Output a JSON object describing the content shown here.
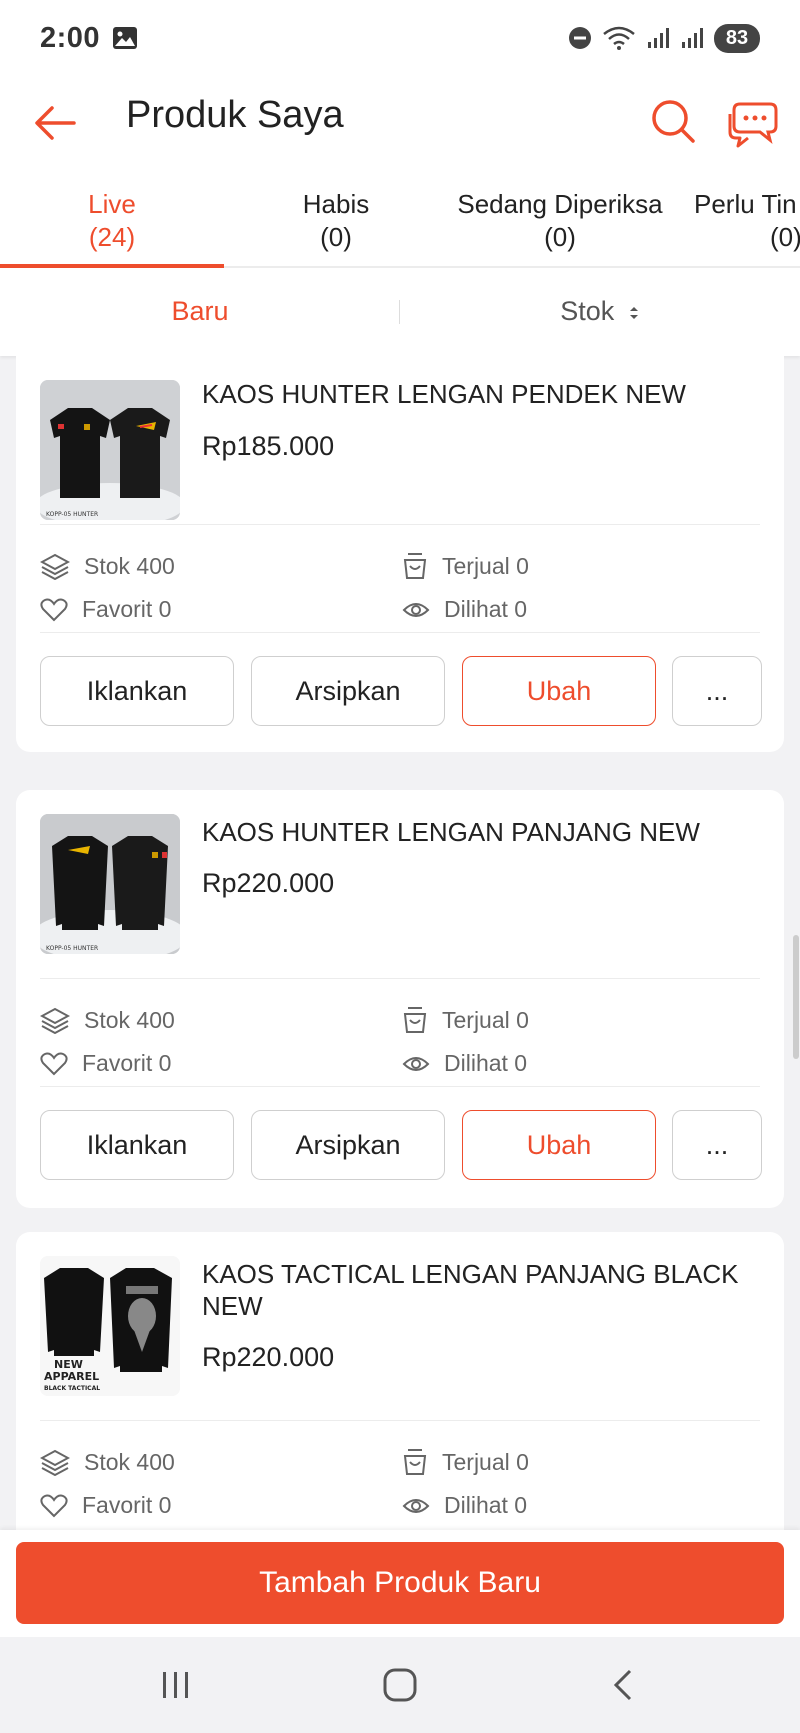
{
  "status_bar": {
    "time": "2:00",
    "battery": "83"
  },
  "app_bar": {
    "title": "Produk Saya"
  },
  "tabs": [
    {
      "label": "Live",
      "count": "(24)"
    },
    {
      "label": "Habis",
      "count": "(0)"
    },
    {
      "label": "Sedang Diperiksa",
      "count": "(0)"
    },
    {
      "label": "Perlu Tin",
      "count": "(0)"
    }
  ],
  "sort": {
    "new_label": "Baru",
    "stock_label": "Stok"
  },
  "products": [
    {
      "name": "KAOS HUNTER LENGAN PENDEK NEW",
      "price": "Rp185.000",
      "stock": "Stok 400",
      "sold": "Terjual 0",
      "favorite": "Favorit 0",
      "views": "Dilihat 0",
      "thumb_caption": "KOPP-05 HUNTER"
    },
    {
      "name": "KAOS HUNTER LENGAN PANJANG NEW",
      "price": "Rp220.000",
      "stock": "Stok 400",
      "sold": "Terjual 0",
      "favorite": "Favorit 0",
      "views": "Dilihat 0",
      "thumb_caption": "KOPP-05 HUNTER"
    },
    {
      "name": "KAOS TACTICAL LENGAN PANJANG BLACK NEW",
      "price": "Rp220.000",
      "stock": "Stok 400",
      "sold": "Terjual 0",
      "favorite": "Favorit 0",
      "views": "Dilihat 0",
      "thumb_caption_1": "NEW",
      "thumb_caption_2": "APPAREL",
      "thumb_caption_3": "BLACK TACTICAL"
    }
  ],
  "actions": {
    "promote": "Iklankan",
    "archive": "Arsipkan",
    "edit": "Ubah",
    "more": "..."
  },
  "bottom": {
    "add_product": "Tambah Produk Baru"
  },
  "colors": {
    "accent": "#ee4d2d",
    "background": "#f2f2f4"
  },
  "icons": {
    "back": "arrow-left-icon",
    "search": "search-icon",
    "chat": "chat-icon",
    "stock": "layers-icon",
    "sold": "basket-icon",
    "favorite": "heart-icon",
    "views": "eye-icon"
  }
}
